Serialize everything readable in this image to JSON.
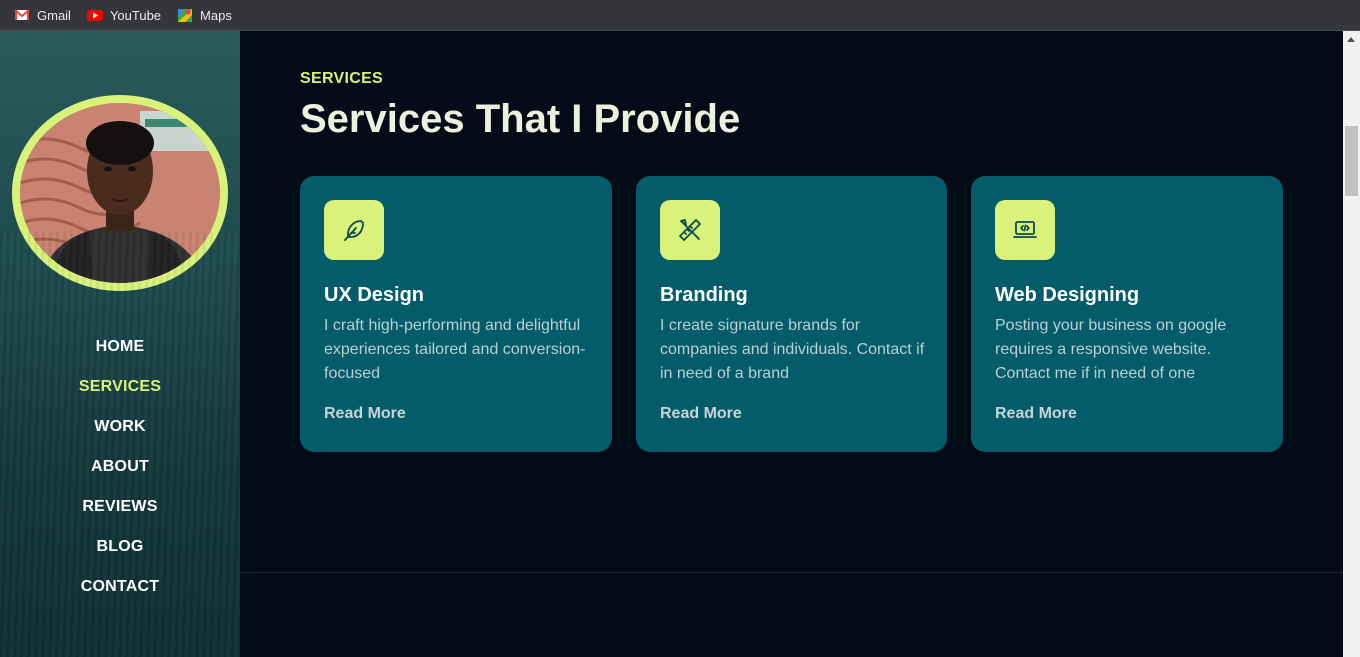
{
  "bookmarks": [
    {
      "label": "Gmail",
      "icon": "gmail-icon"
    },
    {
      "label": "YouTube",
      "icon": "youtube-icon"
    },
    {
      "label": "Maps",
      "icon": "maps-icon"
    }
  ],
  "sidebar": {
    "avatar_alt": "profile photo",
    "nav": [
      {
        "label": "HOME",
        "active": false
      },
      {
        "label": "SERVICES",
        "active": true
      },
      {
        "label": "WORK",
        "active": false
      },
      {
        "label": "ABOUT",
        "active": false
      },
      {
        "label": "REVIEWS",
        "active": false
      },
      {
        "label": "BLOG",
        "active": false
      },
      {
        "label": "CONTACT",
        "active": false
      }
    ]
  },
  "services": {
    "eyebrow": "SERVICES",
    "heading": "Services That I Provide",
    "cards": [
      {
        "icon": "feather-pen-icon",
        "title": "UX Design",
        "description": "I craft high-performing and delightful experiences tailored and conversion-focused",
        "link": "Read More"
      },
      {
        "icon": "pencil-ruler-icon",
        "title": "Branding",
        "description": "I create signature brands for companies and individuals. Contact if in need of a brand",
        "link": "Read More"
      },
      {
        "icon": "laptop-code-icon",
        "title": "Web Designing",
        "description": "Posting your business on google requires a responsive website. Contact me if in need of one",
        "link": "Read More"
      }
    ]
  },
  "colors": {
    "accent": "#d9f37a",
    "card": "#045b6a",
    "background": "#020b17",
    "sidebar": "#1d4a4d"
  }
}
